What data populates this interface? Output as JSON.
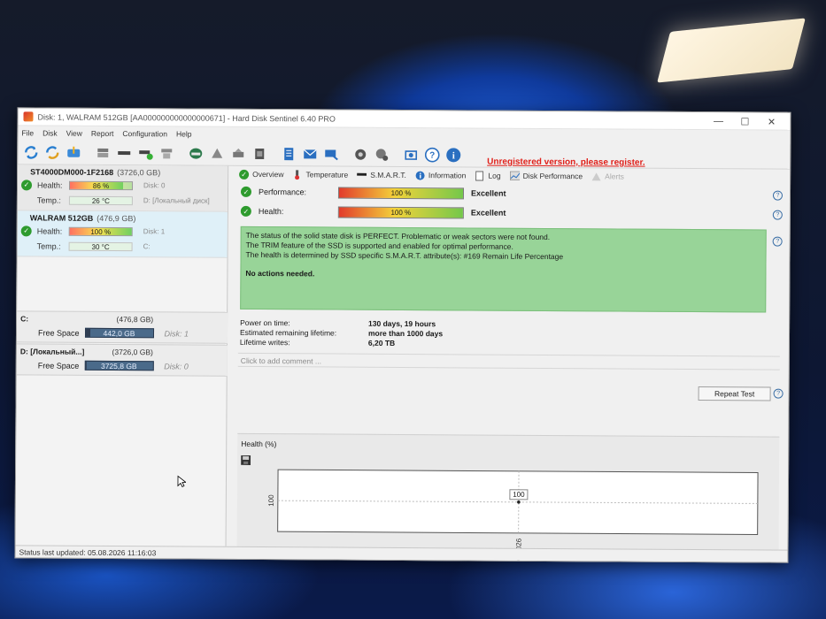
{
  "window": {
    "title": "Disk: 1, WALRAM 512GB [AA000000000000000671]  -  Hard Disk Sentinel 6.40 PRO",
    "controls": [
      "—",
      "☐",
      "✕"
    ]
  },
  "menu": [
    "File",
    "Disk",
    "View",
    "Report",
    "Configuration",
    "Help"
  ],
  "toolbar": {
    "icons": [
      "refresh-icon",
      "refresh-all-icon",
      "backup-icon",
      "disk-icon",
      "disk-green-icon",
      "disk-flag-icon",
      "drive-icon",
      "warning-disk-icon",
      "tools-icon",
      "upload-icon",
      "report-icon",
      "mail-icon",
      "send-icon",
      "settings-icon",
      "gear2-icon",
      "camera-icon",
      "help-icon",
      "info-icon"
    ],
    "unregistered": "Unregistered version, please register."
  },
  "disks": [
    {
      "name": "ST4000DM000-1F2168",
      "size": "(3726,0 GB)",
      "health_label": "Health:",
      "health": "86 %",
      "health_pct": 86,
      "health_extra": "Disk: 0",
      "temp_label": "Temp.:",
      "temp": "26 °C",
      "temp_extra": "D: [Локальный диск]"
    },
    {
      "name": "WALRAM 512GB",
      "size": "(476,9 GB)",
      "health_label": "Health:",
      "health": "100 %",
      "health_pct": 100,
      "health_extra": "Disk: 1",
      "temp_label": "Temp.:",
      "temp": "30 °C",
      "temp_extra": "C:"
    }
  ],
  "partitions": [
    {
      "name": "C:",
      "size": "(476,8 GB)",
      "free_label": "Free Space",
      "free": "442,0 GB",
      "used_pct": 7,
      "disk": "Disk: 1"
    },
    {
      "name": "D: [Локальный...]",
      "size": "(3726,0 GB)",
      "free_label": "Free Space",
      "free": "3725,8 GB",
      "used_pct": 1,
      "disk": "Disk: 0"
    }
  ],
  "tabs": [
    {
      "label": "Overview",
      "icon": "check-icon"
    },
    {
      "label": "Temperature",
      "icon": "thermometer-icon"
    },
    {
      "label": "S.M.A.R.T.",
      "icon": "dash-icon"
    },
    {
      "label": "Information",
      "icon": "info-icon"
    },
    {
      "label": "Log",
      "icon": "document-icon"
    },
    {
      "label": "Disk Performance",
      "icon": "performance-icon"
    },
    {
      "label": "Alerts",
      "icon": "alert-icon"
    }
  ],
  "overview": {
    "performance_label": "Performance:",
    "performance": "100 %",
    "performance_pct": 100,
    "performance_word": "Excellent",
    "health_label": "Health:",
    "health": "100 %",
    "health_pct": 100,
    "health_word": "Excellent",
    "summary_lines": [
      "The status of the solid state disk is PERFECT. Problematic or weak sectors were not found.",
      "The TRIM feature of the SSD is supported and enabled for optimal performance.",
      "The health is determined by SSD specific S.M.A.R.T. attribute(s):  #169 Remain Life Percentage"
    ],
    "summary_action": "No actions needed.",
    "stats": [
      {
        "label": "Power on time:",
        "value": "130 days, 19 hours"
      },
      {
        "label": "Estimated remaining lifetime:",
        "value": "more than 1000 days"
      },
      {
        "label": "Lifetime writes:",
        "value": "6,20 TB"
      }
    ],
    "repeat_button": "Repeat Test",
    "comment_placeholder": "Click to add comment ..."
  },
  "chart_data": {
    "type": "line",
    "title": "Health (%)",
    "x": [
      "05.08.2026"
    ],
    "series": [
      {
        "values": [
          100
        ]
      }
    ],
    "yticks": [
      "100"
    ],
    "data_labels": [
      "100"
    ]
  },
  "statusbar": "Status last updated: 05.08.2026 11:16:03",
  "colors": {
    "accent_ok": "#2e9b2e",
    "summary_bg": "#98d498",
    "unregistered": "#e0201a"
  }
}
